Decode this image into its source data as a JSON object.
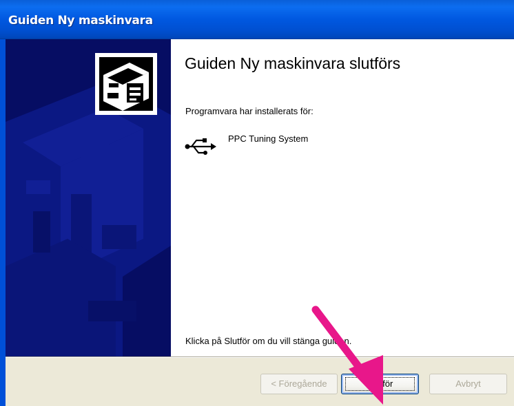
{
  "window": {
    "title": "Guiden Ny maskinvara"
  },
  "content": {
    "heading": "Guiden Ny maskinvara slutförs",
    "installed_label": "Programvara har installerats för:",
    "device_name": "PPC Tuning System",
    "device_icon": "usb-icon",
    "finish_hint": "Klicka på Slutför om du vill stänga guiden."
  },
  "buttons": {
    "previous_label": "< Föregående",
    "finish_label": "Slutför",
    "cancel_label": "Avbryt"
  },
  "colors": {
    "titlebar": "#0058e0",
    "banner": "#060d63",
    "dialog_background": "#ece9d8",
    "annotation_arrow": "#e8178a"
  }
}
